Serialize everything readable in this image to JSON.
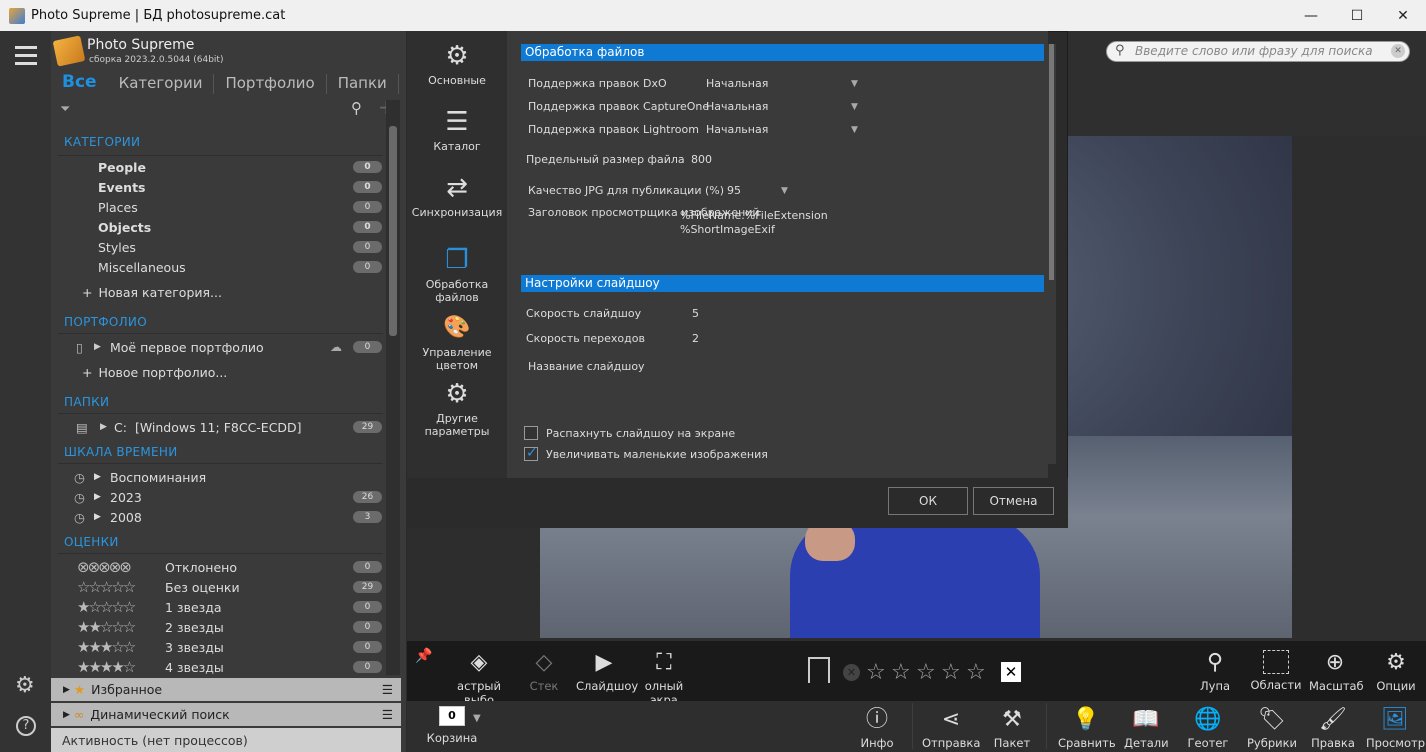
{
  "window": {
    "title": "Photo Supreme | БД photosupreme.cat",
    "minimize": "—",
    "maximize": "☐",
    "close": "✕"
  },
  "app": {
    "name": "Photo Supreme",
    "build": "сборка 2023.2.0.5044 (64bit)"
  },
  "tabs": [
    {
      "label": "Все"
    },
    {
      "label": "Категории"
    },
    {
      "label": "Портфолио"
    },
    {
      "label": "Папки"
    }
  ],
  "sections": {
    "categories": {
      "title": "КАТЕГОРИИ",
      "items": [
        {
          "label": "People",
          "count": "0"
        },
        {
          "label": "Events",
          "count": "0"
        },
        {
          "label": "Places",
          "count": "0"
        },
        {
          "label": "Objects",
          "count": "0"
        },
        {
          "label": "Styles",
          "count": "0"
        },
        {
          "label": "Miscellaneous",
          "count": "0"
        }
      ],
      "add_label": "Новая категория..."
    },
    "portfolio": {
      "title": "ПОРТФОЛИО",
      "item": {
        "label": "Моё первое портфолио",
        "count": "0"
      },
      "add_label": "Новое портфолио..."
    },
    "folders": {
      "title": "ПАПКИ",
      "item": {
        "drive": "C:",
        "label": "[Windows 11; F8CC-ECDD]",
        "count": "29"
      }
    },
    "timeline": {
      "title": "ШКАЛА ВРЕМЕНИ",
      "items": [
        {
          "label": "Воспоминания",
          "count": ""
        },
        {
          "label": "2023",
          "count": "26"
        },
        {
          "label": "2008",
          "count": "3"
        }
      ]
    },
    "ratings": {
      "title": "ОЦЕНКИ",
      "items": [
        {
          "stars": "⊗⊗⊗⊗⊗",
          "label": "Отклонено",
          "count": "0"
        },
        {
          "stars": "☆☆☆☆☆",
          "label": "Без оценки",
          "count": "29"
        },
        {
          "stars": "★☆☆☆☆",
          "label": "1 звезда",
          "count": "0"
        },
        {
          "stars": "★★☆☆☆",
          "label": "2 звезды",
          "count": "0"
        },
        {
          "stars": "★★★☆☆",
          "label": "3 звезды",
          "count": "0"
        },
        {
          "stars": "★★★★☆",
          "label": "4 звезды",
          "count": "0"
        }
      ]
    }
  },
  "bottom_panels": {
    "favorites": "Избранное",
    "dynamic_search": "Динамический поиск",
    "activity": "Активность (нет процессов)"
  },
  "search": {
    "placeholder": "Введите слово или фразу для поиска"
  },
  "dialog": {
    "nav": [
      {
        "label1": "Основные",
        "label2": "",
        "icon": "gear-icon",
        "glyph": "⚙"
      },
      {
        "label1": "Каталог",
        "label2": "",
        "icon": "catalog-icon",
        "glyph": "☰"
      },
      {
        "label1": "Синхронизация",
        "label2": "",
        "icon": "sync-icon",
        "glyph": "⇄"
      },
      {
        "label1": "Обработка",
        "label2": "файлов",
        "icon": "files-icon",
        "glyph": "❐"
      },
      {
        "label1": "Управление",
        "label2": "цветом",
        "icon": "palette-icon",
        "glyph": "🎨"
      },
      {
        "label1": "Другие",
        "label2": "параметры",
        "icon": "gears-icon",
        "glyph": "⚙"
      }
    ],
    "file_processing": {
      "header": "Обработка файлов",
      "dxo_label": "Поддержка правок DxO",
      "dxo_value": "Начальная",
      "captureone_label": "Поддержка правок CaptureOne",
      "captureone_value": "Начальная",
      "lightroom_label": "Поддержка правок Lightroom",
      "lightroom_value": "Начальная",
      "max_size_label": "Предельный размер файла",
      "max_size_value": "800",
      "jpg_quality_label": "Качество JPG для публикации (%)",
      "jpg_quality_value": "95",
      "viewer_title_label": "Заголовок просмотрщика изображений",
      "viewer_title_value1": "%FileName.%FileExtension",
      "viewer_title_value2": "%ShortImageExif"
    },
    "slideshow": {
      "header": "Настройки слайдшоу",
      "speed_label": "Скорость слайдшоу",
      "speed_value": "5",
      "transition_label": "Скорость переходов",
      "transition_value": "2",
      "name_label": "Название слайдшоу",
      "fullscreen_label": "Распахнуть слайдшоу на экране",
      "fullscreen_checked": false,
      "enlarge_label": "Увеличивать маленькие изображения",
      "enlarge_checked": true
    },
    "ok": "ОК",
    "cancel": "Отмена"
  },
  "toolbar_top": {
    "quick_select": "астрый выбо",
    "stack": "Стек",
    "slideshow": "Слайдшоу",
    "fullscreen": "олный экра",
    "loupe": "Лупа",
    "areas": "Области",
    "zoom": "Масштаб",
    "options": "Опции"
  },
  "toolbar_bottom": {
    "basket": "Корзина",
    "basket_count": "0",
    "info": "Инфо",
    "send": "Отправка",
    "batch": "Пакет",
    "compare": "Сравнить",
    "details": "Детали",
    "geotag": "Геотег",
    "rubrics": "Рубрики",
    "edit": "Правка",
    "view": "Просмотр"
  },
  "colors": {
    "accent": "#0e7ad4",
    "section_title": "#2a96e0",
    "panel": "#3a3a3a"
  }
}
